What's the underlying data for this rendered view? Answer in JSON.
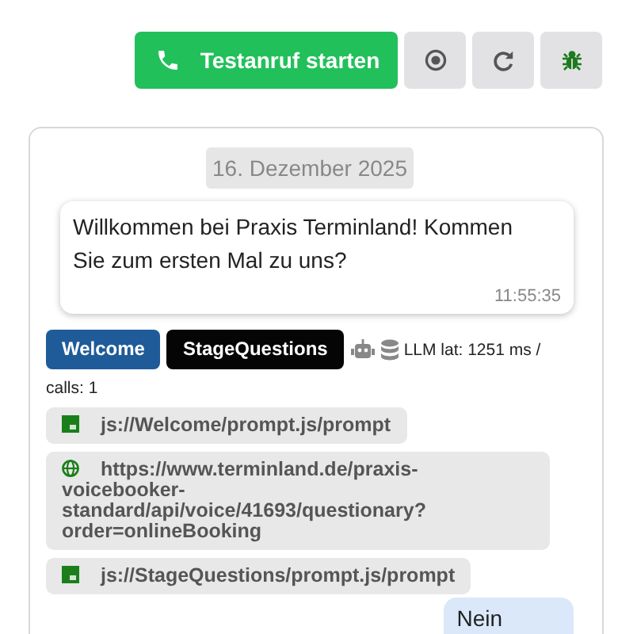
{
  "toolbar": [
    {
      "kind": "call",
      "label": "Testanruf starten"
    },
    {
      "kind": "stop"
    },
    {
      "kind": "reload"
    },
    {
      "kind": "debug"
    }
  ],
  "chat": {
    "date": "16. Dezember 2025",
    "bot_message": {
      "text": "Willkommen bei Praxis Terminland! Kommen Sie zum ersten Mal zu uns?",
      "time": "11:55:35"
    },
    "tags": [
      {
        "label": "Welcome",
        "color": "#1f5b99"
      },
      {
        "label": "StageQuestions",
        "color": "#050505"
      }
    ],
    "stats": [
      "LLM lat: 1251 ms /",
      "calls: 1"
    ],
    "resources": [
      {
        "kind": "js",
        "url": "js://Welcome/prompt.js/prompt"
      },
      {
        "kind": "web",
        "url": "https://www.terminland.de/praxis-voicebooker-standard/api/voice/41693/questionary?order=onlineBooking"
      },
      {
        "kind": "js",
        "url": "js://StageQuestions/prompt.js/prompt"
      }
    ],
    "user_message": {
      "text": "Nein"
    }
  }
}
